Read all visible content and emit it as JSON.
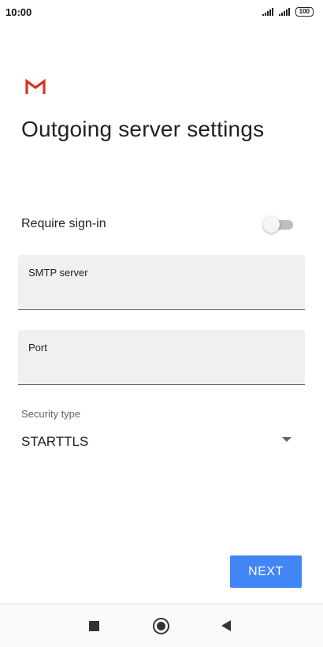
{
  "status_bar": {
    "time": "10:00",
    "battery": "100",
    "signal_icons": [
      "signal-strength-icon",
      "signal-strength-icon"
    ]
  },
  "app": {
    "logo_icon": "gmail-logo-icon",
    "logo_color": "#d93025"
  },
  "page": {
    "title": "Outgoing server settings"
  },
  "require_signin": {
    "label": "Require sign-in",
    "enabled": false
  },
  "smtp_server": {
    "label": "SMTP server",
    "value": ""
  },
  "port": {
    "label": "Port",
    "value": ""
  },
  "security_type": {
    "label": "Security type",
    "value": "STARTTLS"
  },
  "actions": {
    "next_label": "NEXT",
    "accent_color": "#4285f4"
  },
  "nav_bar": {
    "icons": [
      "recents-square-icon",
      "home-circle-icon",
      "back-triangle-icon"
    ]
  }
}
